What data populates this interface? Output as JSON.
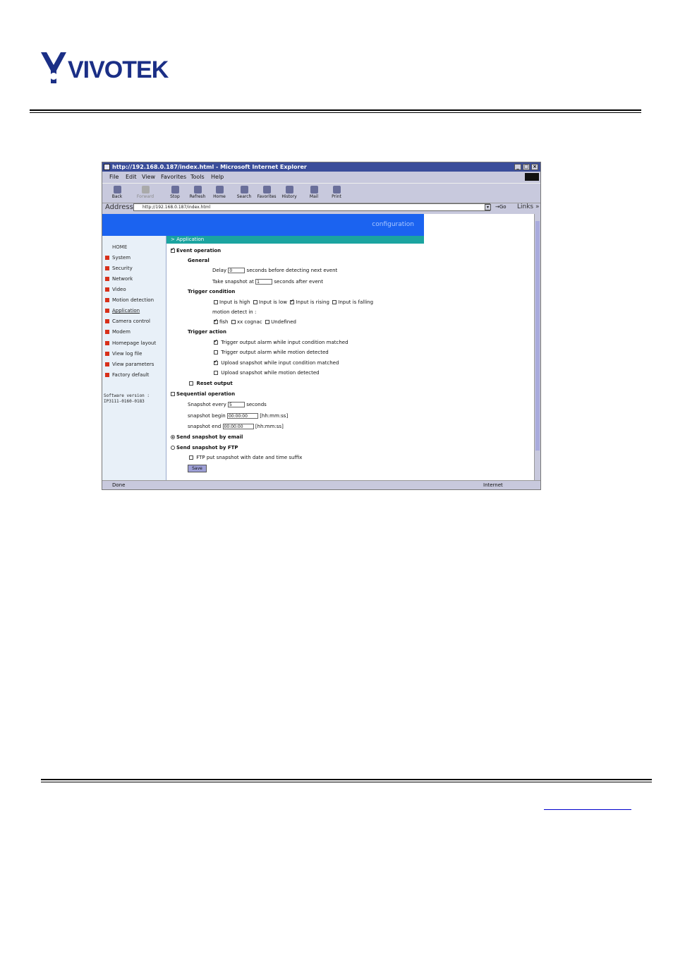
{
  "header": {
    "logo_text": "VIVOTEK"
  },
  "browser": {
    "title": "http://192.168.0.187/index.html - Microsoft Internet Explorer",
    "menu": [
      "File",
      "Edit",
      "View",
      "Favorites",
      "Tools",
      "Help"
    ],
    "toolbar": [
      "Back",
      "Forward",
      "Stop",
      "Refresh",
      "Home",
      "Search",
      "Favorites",
      "History",
      "Mail",
      "Print"
    ],
    "address_label": "Address",
    "address_value": "http://192.168.0.187/index.html",
    "go_label": "Go",
    "links_label": "Links",
    "status_left": "Done",
    "status_right": "Internet"
  },
  "page": {
    "banner_text": "configuration",
    "section_title": "> Application",
    "nav_home": "HOME",
    "nav_items": [
      "System",
      "Security",
      "Network",
      "Video",
      "Motion detection",
      "Application",
      "Camera control",
      "Modem",
      "Homepage layout",
      "View log file",
      "View parameters",
      "Factory default"
    ],
    "software_version_label": "Software version :",
    "software_version": "IP3111-0160-0183",
    "event_operation": "Event operation",
    "general": "General",
    "delay_label": "Delay",
    "delay_value": "0",
    "delay_suffix": "seconds before detecting next event",
    "take_snapshot_label": "Take snapshot at",
    "take_snapshot_value": "1",
    "take_snapshot_suffix": "seconds after event",
    "trigger_condition": "Trigger condition",
    "input_high": "Input is high",
    "input_low": "Input is low",
    "input_rising": "Input is rising",
    "input_falling": "Input is falling",
    "motion_detect_in": "motion detect in :",
    "fish": "fish",
    "xx_cognac": "xx cognac",
    "undefined": "Undefined",
    "trigger_action": "Trigger action",
    "action_1": "Trigger output alarm while input condition matched",
    "action_2": "Trigger output alarm while motion detected",
    "action_3": "Upload snapshot while input condition matched",
    "action_4": "Upload snapshot while motion detected",
    "reset_output": "Reset output",
    "sequential_operation": "Sequential operation",
    "snapshot_every_label": "Snapshot every",
    "snapshot_every_value": "5",
    "snapshot_every_suffix": "seconds",
    "snapshot_begin_label": "snapshot begin",
    "snapshot_begin_value": "00:00:00",
    "snapshot_begin_suffix": "[hh:mm:ss]",
    "snapshot_end_label": "snapshot end",
    "snapshot_end_value": "00:00:00",
    "snapshot_end_suffix": "[hh:mm:ss]",
    "send_email": "Send snapshot by email",
    "send_ftp": "Send snapshot by FTP",
    "ftp_suffix": "FTP put snapshot with date and time suffix",
    "save_label": "Save"
  }
}
